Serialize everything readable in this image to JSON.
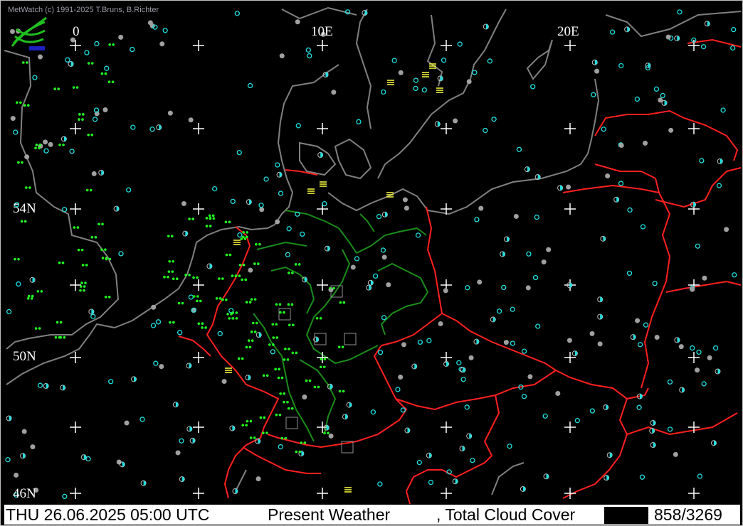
{
  "header": {
    "copyright": "MetWatch  (c) 1991-2025 T.Bruns, B.Richter"
  },
  "map": {
    "longitude_labels": [
      "0",
      "10E",
      "20E"
    ],
    "latitude_labels": [
      "54N",
      "50N",
      "46N"
    ],
    "colors": {
      "coast": "#808080",
      "borders": "#ff2020",
      "german_states": "#1a8c1a",
      "grid": "#ffffff",
      "cloud_ok": "#20e0e0",
      "rain": "#20ff20",
      "fog": "#ffff40"
    }
  },
  "status": {
    "datetime": "THU 26.06.2025 05:00 UTC",
    "parameter1": "Present Weather",
    "parameter2": ", Total Cloud Cover",
    "count": "858/3269"
  }
}
